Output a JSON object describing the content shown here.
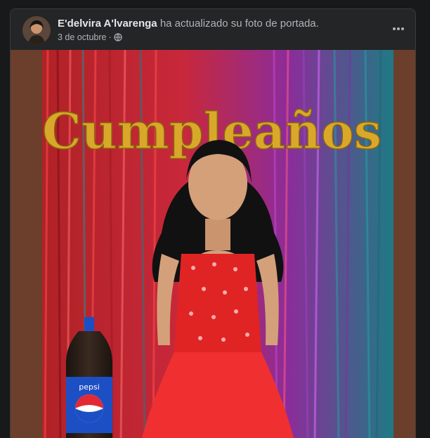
{
  "post": {
    "author_name": "E'delvira A'lvarenga",
    "action_text": " ha actualizado su foto de portada.",
    "date": "3 de octubre",
    "separator": " · ",
    "privacy_icon": "globe-icon",
    "menu_icon": "more-horizontal-icon"
  },
  "photo": {
    "banner_text": "Cumpleaños",
    "bottle_label": "pepsi"
  },
  "colors": {
    "background": "#18191a",
    "card": "#242526",
    "text_primary": "#e4e6eb",
    "text_secondary": "#b0b3b8",
    "photo_frame": "#6b3f2c",
    "dress_red": "#e02424",
    "balloon_gold": "#d9a82a"
  }
}
